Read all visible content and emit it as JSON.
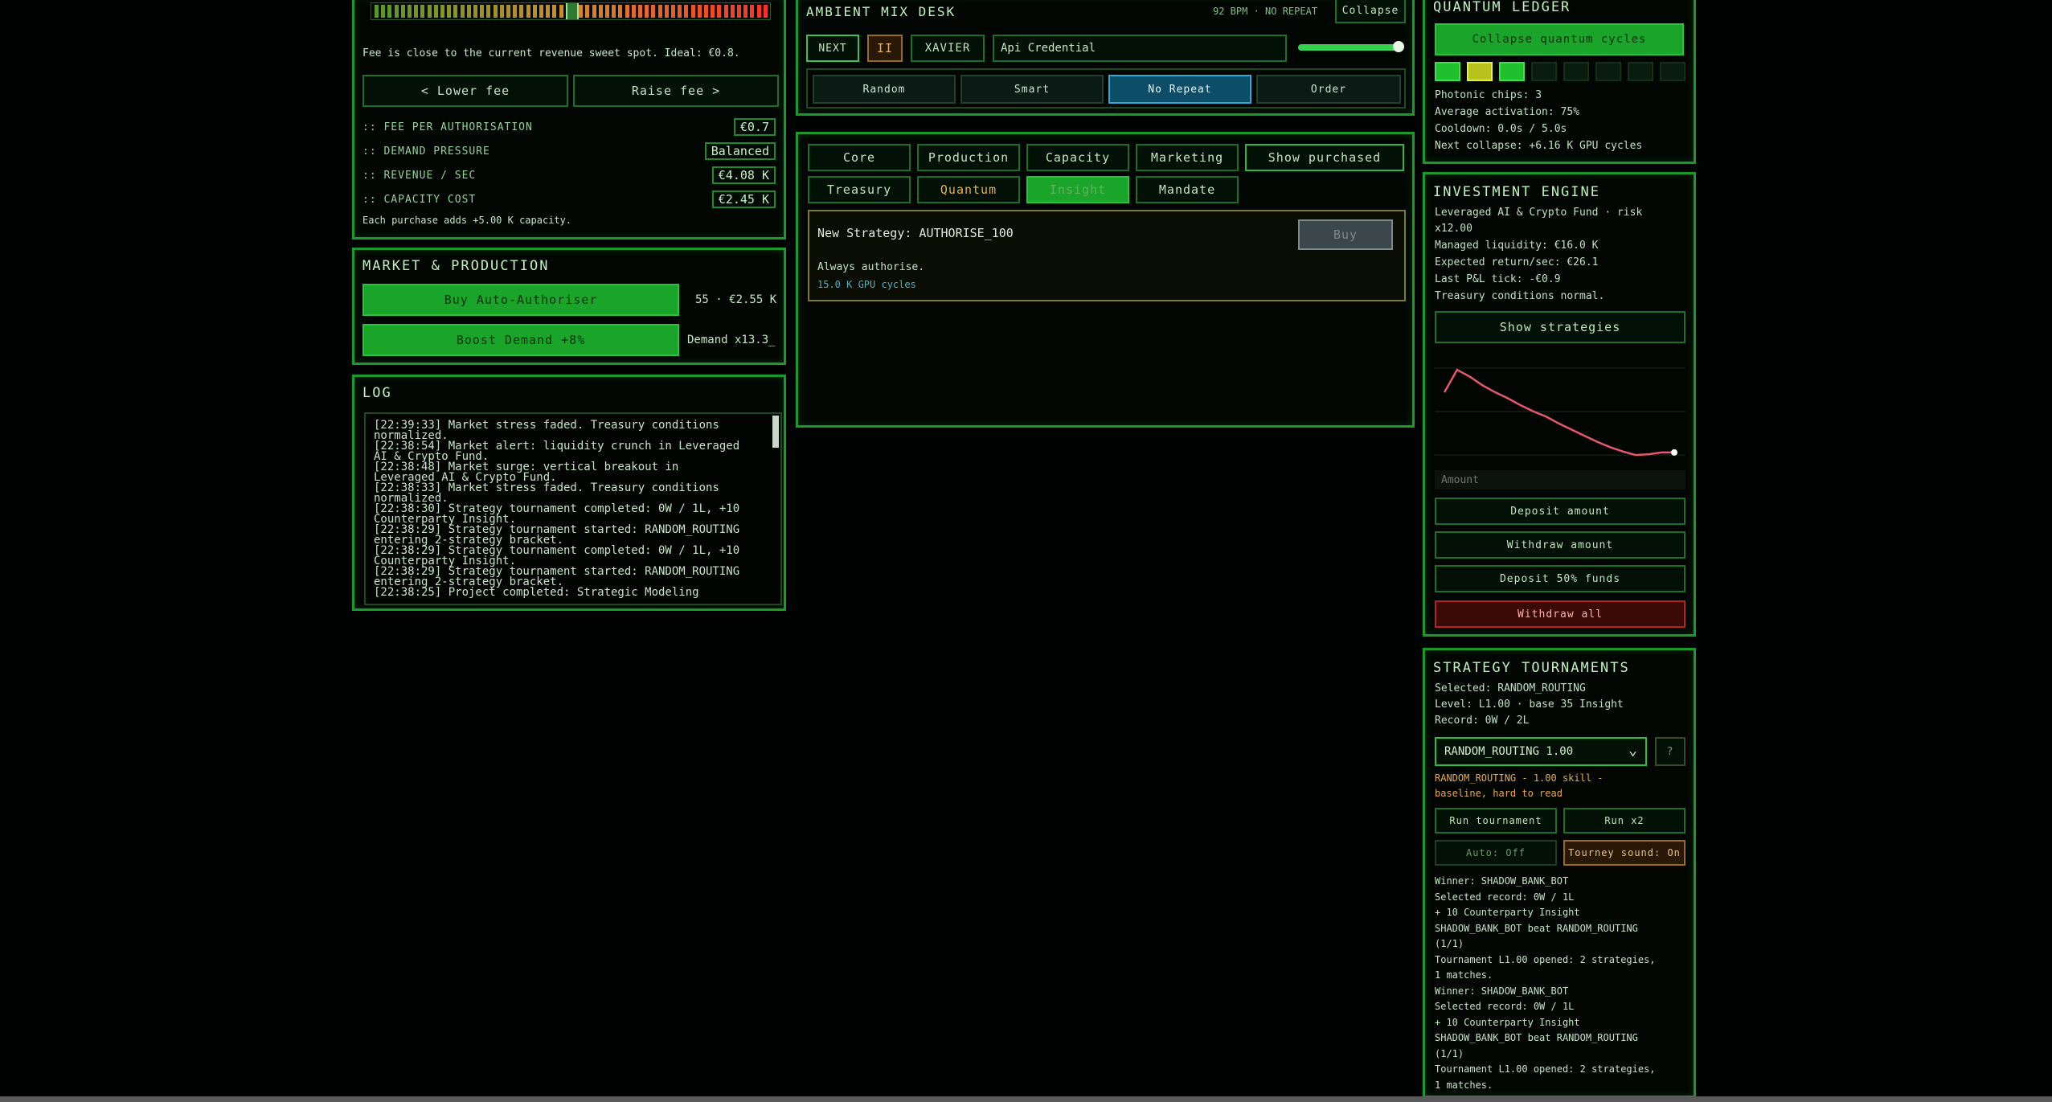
{
  "fee": {
    "hint": "Fee is close to the current revenue sweet spot. Ideal: €0.8.",
    "lower_label": "< Lower fee",
    "raise_label": "Raise fee >",
    "rows": [
      {
        "label": ":: FEE PER AUTHORISATION",
        "value": "€0.7"
      },
      {
        "label": ":: DEMAND PRESSURE",
        "value": "Balanced"
      },
      {
        "label": ":: REVENUE / SEC",
        "value": "€4.08 K"
      },
      {
        "label": ":: CAPACITY COST",
        "value": "€2.45 K"
      }
    ],
    "footnote": "Each purchase adds +5.00 K capacity."
  },
  "market": {
    "title": "MARKET & PRODUCTION",
    "buy_label": "Buy Auto-Authoriser",
    "buy_info": "55 · €2.55 K",
    "boost_label": "Boost Demand +8%",
    "boost_info": "Demand x13.3_"
  },
  "log": {
    "title": "LOG",
    "lines": [
      "[22:39:33] Market stress faded. Treasury conditions",
      "normalized.",
      "[22:38:54] Market alert: liquidity crunch in Leveraged",
      "AI & Crypto Fund.",
      "[22:38:48] Market surge: vertical breakout in",
      "Leveraged AI & Crypto Fund.",
      "[22:38:33] Market stress faded. Treasury conditions",
      "normalized.",
      "[22:38:30] Strategy tournament completed: 0W / 1L, +10",
      "Counterparty Insight.",
      "[22:38:29] Strategy tournament started: RANDOM_ROUTING",
      "entering 2-strategy bracket.",
      "[22:38:29] Strategy tournament completed: 0W / 1L, +10",
      "Counterparty Insight.",
      "[22:38:29] Strategy tournament started: RANDOM_ROUTING",
      "entering 2-strategy bracket.",
      "[22:38:25] Project completed: Strategic Modeling"
    ]
  },
  "mix": {
    "title": "AMBIENT MIX DESK",
    "status": "92 BPM · NO REPEAT",
    "collapse_label": "Collapse",
    "next_label": "NEXT",
    "pause_label": "II",
    "track_label": "XAVIER",
    "track_input": "Api Credential",
    "volume": 0.95,
    "modes": [
      "Random",
      "Smart",
      "No Repeat",
      "Order"
    ],
    "active_mode": "No Repeat"
  },
  "projects": {
    "tabs_row1": [
      "Core",
      "Production",
      "Capacity",
      "Marketing",
      "Show purchased"
    ],
    "tabs_row2": [
      "Treasury",
      "Quantum",
      "Insight",
      "Mandate"
    ],
    "active_tab": "Insight",
    "card": {
      "title": "New Strategy: AUTHORISE_100",
      "desc": "Always authorise.",
      "cost": "15.0 K GPU cycles",
      "buy_label": "Buy"
    }
  },
  "quantum": {
    "title": "QUANTUM LEDGER",
    "collapse_label": "Collapse quantum cycles",
    "chips_active": 3,
    "chips_total": 8,
    "lines": [
      "Photonic chips: 3",
      "Average activation: 75%",
      "Cooldown: 0.0s / 5.0s",
      "Next collapse: +6.16 K GPU cycles"
    ],
    "colors": {
      "chip_a": "#1fbf2e",
      "chip_b": "#b8c21d",
      "chip_off": "#0a1c0d"
    }
  },
  "investment": {
    "title": "INVESTMENT ENGINE",
    "lines": [
      "Leveraged AI & Crypto Fund · risk",
      "x12.00",
      "Managed liquidity: €16.0 K",
      "Expected return/sec: €26.1",
      "Last P&L tick: -€0.9",
      "Treasury conditions normal."
    ],
    "show_label": "Show strategies",
    "amount_placeholder": "Amount",
    "deposit_label": "Deposit amount",
    "withdraw_label": "Withdraw amount",
    "deposit50_label": "Deposit 50% funds",
    "withdraw_all_label": "Withdraw all"
  },
  "chart_data": {
    "type": "line",
    "title": "",
    "xlabel": "",
    "ylabel": "",
    "x": [
      0,
      1,
      2,
      3,
      4,
      5,
      6,
      7,
      8,
      9,
      10,
      11,
      12,
      13,
      14,
      15,
      16,
      17,
      18
    ],
    "series": [
      {
        "values": [
          0.72,
          0.98,
          0.9,
          0.8,
          0.72,
          0.65,
          0.57,
          0.5,
          0.44,
          0.36,
          0.29,
          0.22,
          0.15,
          0.09,
          0.04,
          0.0,
          0.01,
          0.03,
          0.03
        ]
      }
    ],
    "ylim": [
      -0.1,
      1.1
    ],
    "grid": true,
    "color": "#e7586a"
  },
  "tournaments": {
    "title": "STRATEGY TOURNAMENTS",
    "lines": [
      "Selected: RANDOM_ROUTING",
      "Level: L1.00 · base 35 Insight",
      "Record: 0W / 2L"
    ],
    "select_value": "RANDOM_ROUTING  1.00",
    "help_label": "?",
    "desc_lines": [
      "RANDOM_ROUTING - 1.00 skill -",
      "baseline, hard to read"
    ],
    "run_label": "Run tournament",
    "run2_label": "Run x2",
    "auto_label": "Auto: Off",
    "sound_label": "Tourney sound: On",
    "results": [
      "Winner: SHADOW_BANK_BOT",
      "Selected record: 0W / 1L",
      "+ 10 Counterparty Insight",
      "SHADOW_BANK_BOT beat RANDOM_ROUTING",
      "(1/1)",
      "Tournament L1.00 opened: 2 strategies,",
      "1 matches.",
      "Winner: SHADOW_BANK_BOT",
      "Selected record: 0W / 1L",
      "+ 10 Counterparty Insight",
      "SHADOW_BANK_BOT beat RANDOM_ROUTING",
      "(1/1)",
      "Tournament L1.00 opened: 2 strategies,",
      "1 matches."
    ]
  }
}
